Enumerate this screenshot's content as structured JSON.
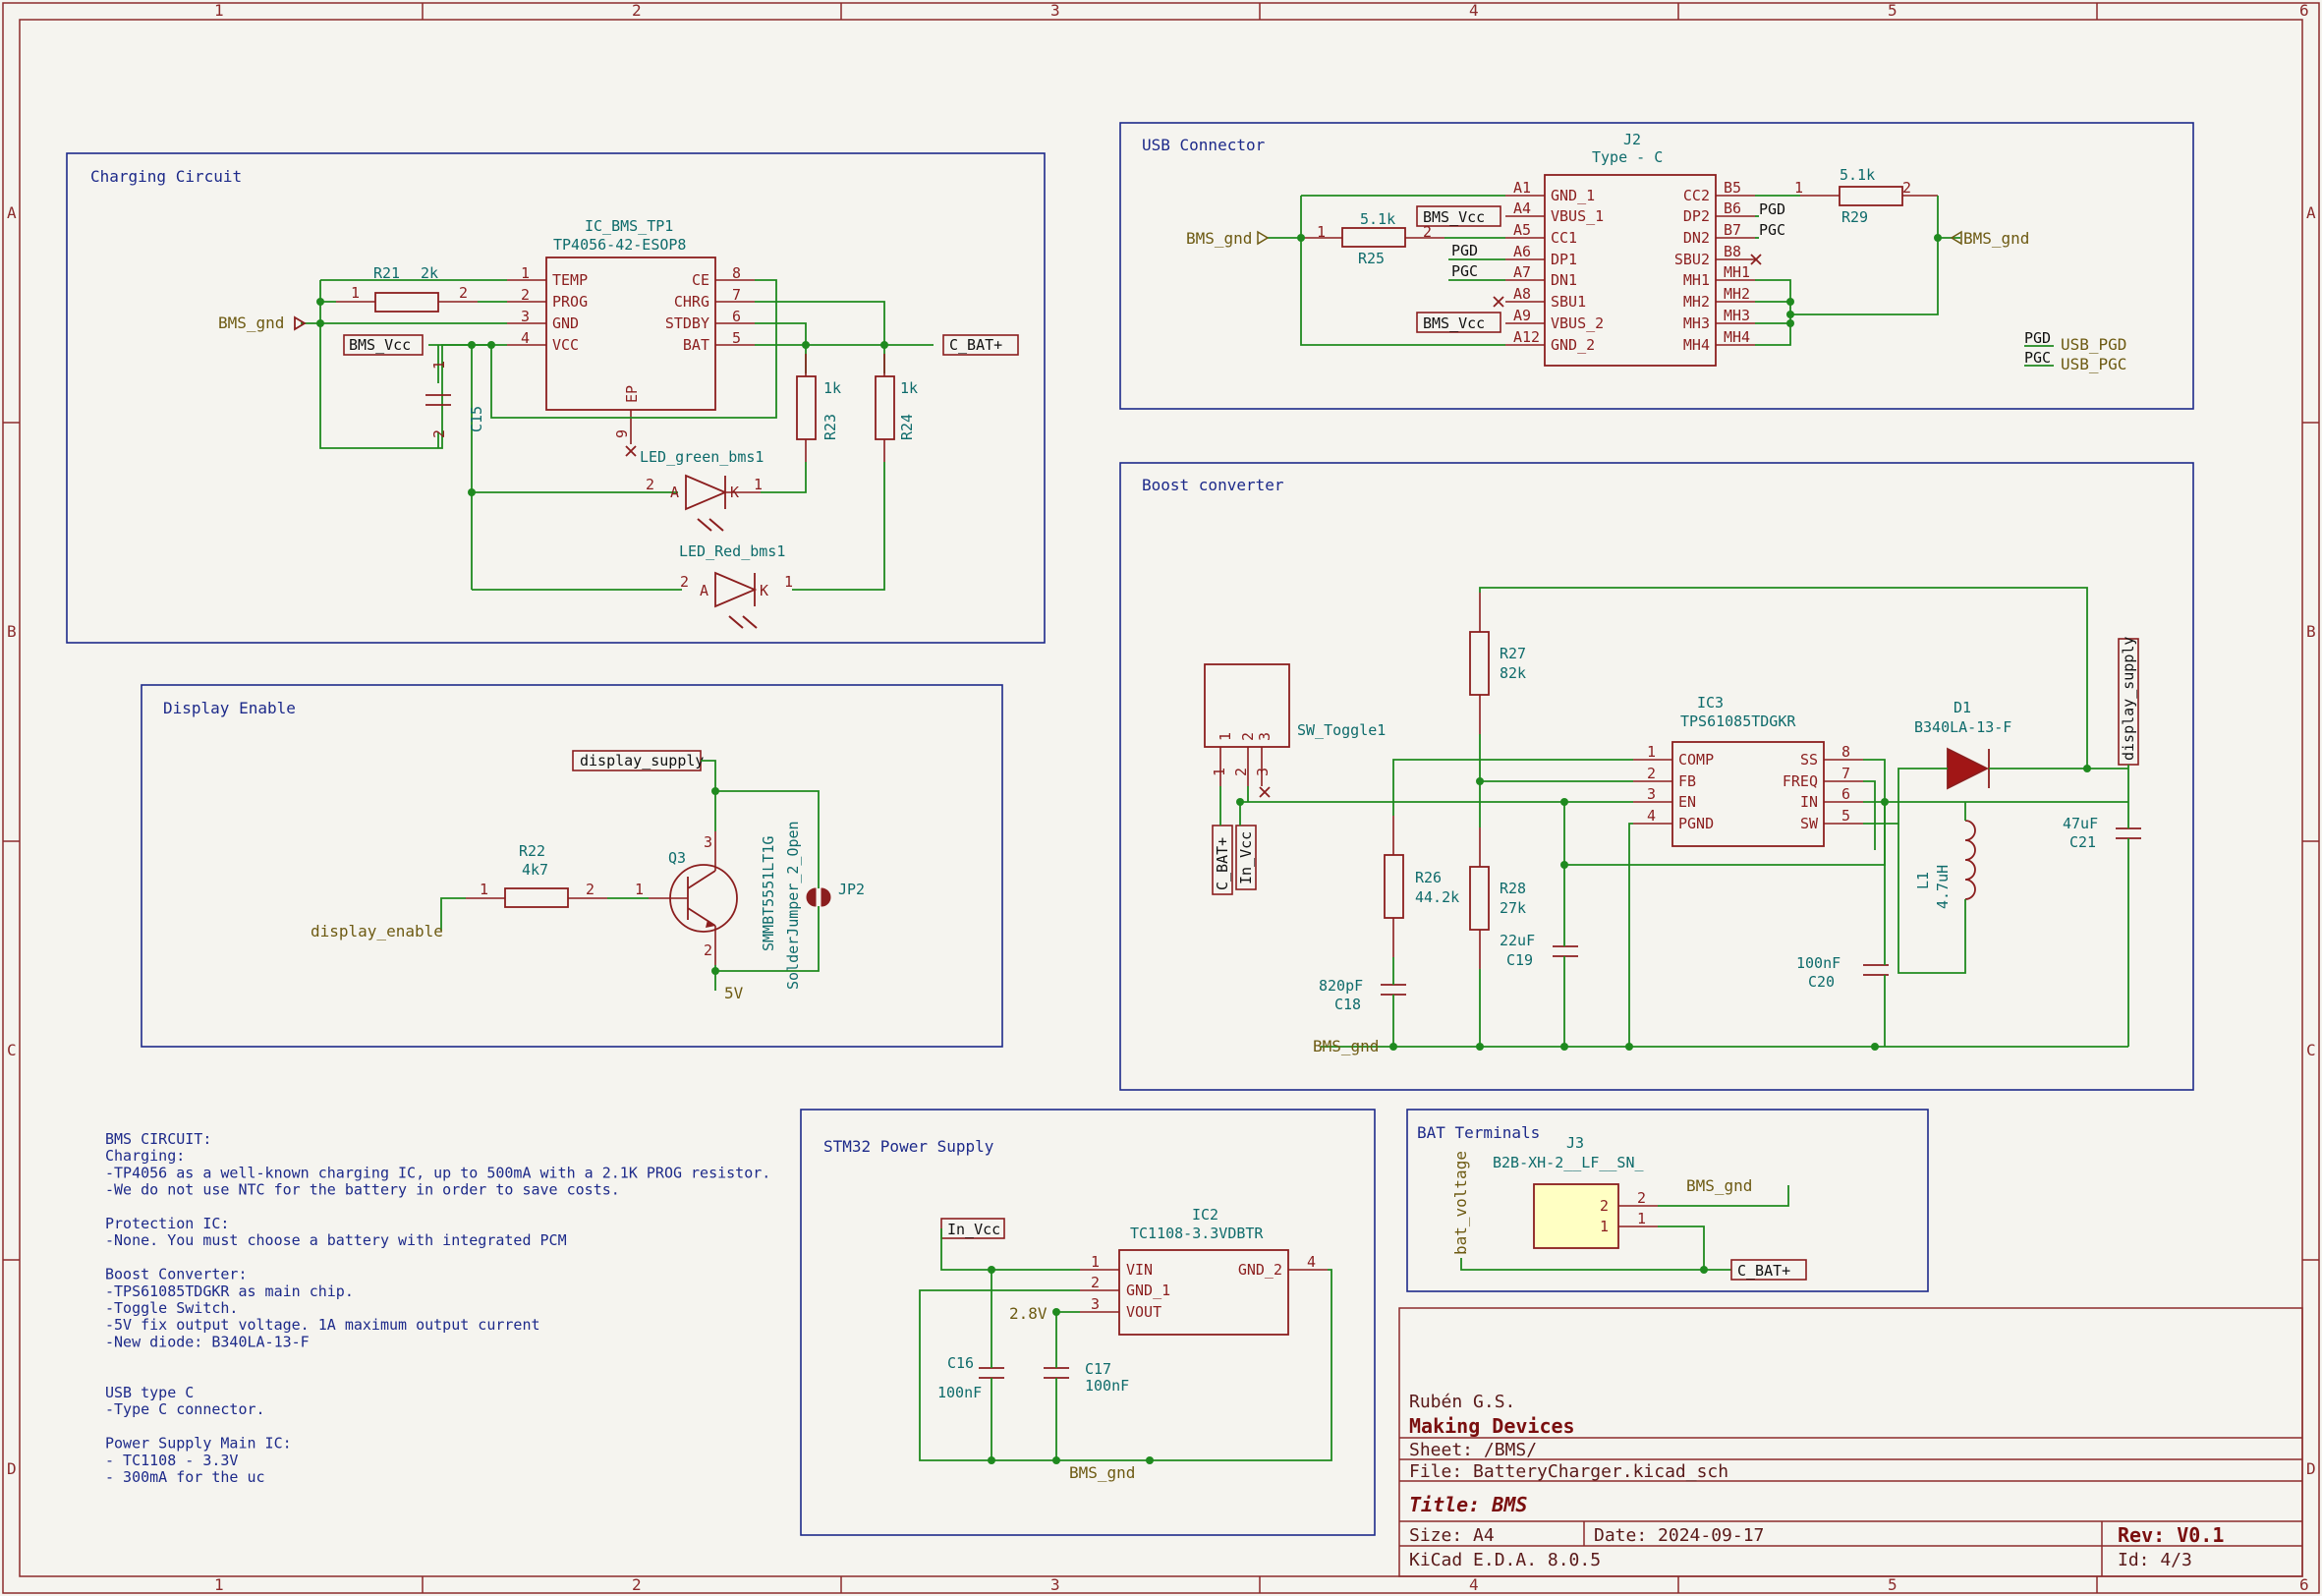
{
  "frame": {
    "columns": [
      "1",
      "2",
      "3",
      "4",
      "5",
      "6"
    ],
    "rows": [
      "A",
      "B",
      "C",
      "D"
    ]
  },
  "title_block": {
    "company_line": "Rubén G.S.",
    "organization": "Making Devices",
    "sheet": "Sheet: /BMS/",
    "file": "File: BatteryCharger.kicad_sch",
    "title": "Title: BMS",
    "size": "Size: A4",
    "date": "Date: 2024-09-17",
    "rev": "Rev: V0.1",
    "tool": "KiCad E.D.A. 8.0.5",
    "id": "Id: 4/3"
  },
  "blocks": {
    "charging": "Charging Circuit",
    "usb": "USB Connector",
    "boost": "Boost converter",
    "display": "Display Enable",
    "stm32": "STM32 Power Supply",
    "bat": "BAT Terminals"
  },
  "notes": [
    "BMS CIRCUIT:",
    "Charging:",
    "-TP4056 as a well-known charging IC, up to 500mA with a 2.1K PROG resistor.",
    "-We do not use NTC for the battery in order to save costs.",
    "",
    "Protection IC:",
    "-None. You must choose a battery with integrated PCM",
    "",
    "Boost Converter:",
    "-TPS61085TDGKR as main chip.",
    "-Toggle Switch.",
    "-5V fix output voltage. 1A maximum output current",
    "-New diode: B340LA-13-F",
    "",
    "",
    "USB type C",
    "-Type C connector.",
    "",
    "Power Supply Main IC:",
    "- TC1108 - 3.3V",
    "- 300mA for the uc"
  ],
  "charging": {
    "ic_ref": "IC_BMS_TP1",
    "ic_val": "TP4056-42-ESOP8",
    "left_pins": [
      {
        "num": "1",
        "name": "TEMP"
      },
      {
        "num": "2",
        "name": "PROG"
      },
      {
        "num": "3",
        "name": "GND"
      },
      {
        "num": "4",
        "name": "VCC"
      }
    ],
    "right_pins": [
      {
        "num": "8",
        "name": "CE"
      },
      {
        "num": "7",
        "name": "CHRG"
      },
      {
        "num": "6",
        "name": "STDBY"
      },
      {
        "num": "5",
        "name": "BAT"
      }
    ],
    "ep_name": "EP",
    "ep_num": "9",
    "r21_ref": "R21",
    "r21_val": "2k",
    "r23_ref": "R23",
    "r23_val": "1k",
    "r24_ref": "R24",
    "r24_val": "1k",
    "c15_ref": "C15",
    "led_green": "LED_green_bms1",
    "led_red": "LED_Red_bms1",
    "net_gnd": "BMS_gnd",
    "net_vcc": "BMS_Vcc",
    "net_bat": "C_BAT+"
  },
  "usb": {
    "ref": "J2",
    "val": "Type - C",
    "left_pins": [
      {
        "num": "A1",
        "name": "GND_1"
      },
      {
        "num": "A4",
        "name": "VBUS_1"
      },
      {
        "num": "A5",
        "name": "CC1"
      },
      {
        "num": "A6",
        "name": "DP1"
      },
      {
        "num": "A7",
        "name": "DN1"
      },
      {
        "num": "A8",
        "name": "SBU1"
      },
      {
        "num": "A9",
        "name": "VBUS_2"
      },
      {
        "num": "A12",
        "name": "GND_2"
      }
    ],
    "right_pins": [
      {
        "num": "B5",
        "name": "CC2"
      },
      {
        "num": "B6",
        "name": "DP2"
      },
      {
        "num": "B7",
        "name": "DN2"
      },
      {
        "num": "B8",
        "name": "SBU2"
      },
      {
        "num": "MH1",
        "name": "MH1"
      },
      {
        "num": "MH2",
        "name": "MH2"
      },
      {
        "num": "MH3",
        "name": "MH3"
      },
      {
        "num": "MH4",
        "name": "MH4"
      }
    ],
    "r25_ref": "R25",
    "r25_val": "5.1k",
    "r29_ref": "R29",
    "r29_val": "5.1k",
    "pgd": "PGD",
    "pgc": "PGC",
    "usb_pgd": "USB_PGD",
    "usb_pgc": "USB_PGC",
    "net_gnd": "BMS_gnd",
    "net_vcc": "BMS_Vcc"
  },
  "boost": {
    "ic_ref": "IC3",
    "ic_val": "TPS61085TDGKR",
    "left_pins": [
      {
        "num": "1",
        "name": "COMP"
      },
      {
        "num": "2",
        "name": "FB"
      },
      {
        "num": "3",
        "name": "EN"
      },
      {
        "num": "4",
        "name": "PGND"
      }
    ],
    "right_pins": [
      {
        "num": "8",
        "name": "SS"
      },
      {
        "num": "7",
        "name": "FREQ"
      },
      {
        "num": "6",
        "name": "IN"
      },
      {
        "num": "5",
        "name": "SW"
      }
    ],
    "sw_ref": "SW_Toggle1",
    "r27_ref": "R27",
    "r27_val": "82k",
    "r26_ref": "R26",
    "r26_val": "44.2k",
    "r28_ref": "R28",
    "r28_val": "27k",
    "c19_ref": "C19",
    "c19_val": "22uF",
    "c18_ref": "C18",
    "c18_val": "820pF",
    "c20_ref": "C20",
    "c20_val": "100nF",
    "c21_ref": "C21",
    "c21_val": "47uF",
    "l1_ref": "L1",
    "l1_val": "4.7uH",
    "d1_ref": "D1",
    "d1_val": "B340LA-13-F",
    "net_bat": "C_BAT+",
    "net_invcc": "In_Vcc",
    "net_disp": "display_supply",
    "net_gnd": "BMS_gnd"
  },
  "display": {
    "q_ref": "Q3",
    "q_val": "SMMBT5551LT1G",
    "jp_ref": "JP2",
    "jp_val": "SolderJumper_2_Open",
    "r22_ref": "R22",
    "r22_val": "4k7",
    "net_supply": "display_supply",
    "net_enable": "display_enable",
    "net_5v": "5V"
  },
  "stm32": {
    "ic_ref": "IC2",
    "ic_val": "TC1108-3.3VDBTR",
    "left_pins": [
      {
        "num": "1",
        "name": "VIN"
      },
      {
        "num": "2",
        "name": "GND_1"
      },
      {
        "num": "3",
        "name": "VOUT"
      }
    ],
    "right_pin": {
      "num": "4",
      "name": "GND_2"
    },
    "c16_ref": "C16",
    "c16_val": "100nF",
    "c17_ref": "C17",
    "c17_val": "100nF",
    "net_invcc": "In_Vcc",
    "net_28v": "2.8V",
    "net_gnd": "BMS_gnd"
  },
  "bat": {
    "ref": "J3",
    "val": "B2B-XH-2__LF__SN_",
    "net_gnd": "BMS_gnd",
    "net_bat": "C_BAT+",
    "net_voltage": "bat_voltage",
    "pin2": "2",
    "pin1": "1"
  }
}
